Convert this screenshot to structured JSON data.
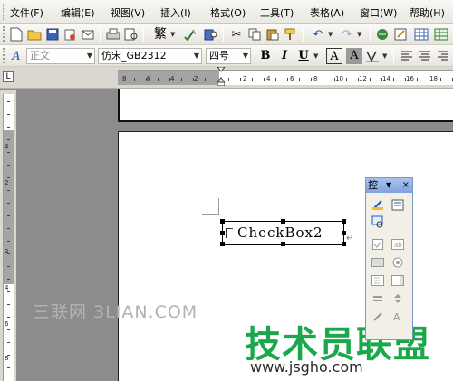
{
  "menubar": {
    "items": [
      "文件(F)",
      "编辑(E)",
      "视图(V)",
      "插入(I)",
      "格式(O)",
      "工具(T)",
      "表格(A)",
      "窗口(W)",
      "帮助(H)"
    ]
  },
  "toolbar_standard": {
    "traditional_label": "繁"
  },
  "toolbar_format": {
    "style_value": "正文",
    "font_value": "仿宋_GB2312",
    "size_value": "四号",
    "bold_label": "B",
    "italic_label": "I",
    "underline_label": "U",
    "char_border_label": "A",
    "char_shade_label": "A"
  },
  "ruler": {
    "corner_label": "L",
    "h_ticks": [
      "8",
      "6",
      "4",
      "2",
      "2",
      "4",
      "6",
      "8",
      "10",
      "12",
      "14",
      "16",
      "18"
    ],
    "v_ticks": [
      "4",
      "2",
      "2",
      "4",
      "6",
      "8"
    ]
  },
  "document": {
    "checkbox_label": "CheckBox2",
    "paragraph_mark": "↵"
  },
  "palette": {
    "title": "控",
    "close": "×"
  },
  "watermarks": {
    "left_text": "三联网 3LIAN.COM",
    "logo_text": "技术员联盟",
    "url_text": "www.jsgho.com"
  },
  "colors": {
    "logo_green": "#1aa84a",
    "palette_title": "#7fa2df"
  }
}
